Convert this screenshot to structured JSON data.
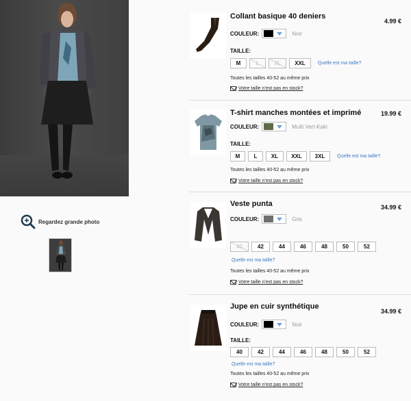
{
  "left": {
    "zoom_label": "Regardez grande photo"
  },
  "colors": {
    "link": "#3a78c2",
    "dropdown_arrow": "#6a9fd4"
  },
  "products": [
    {
      "name": "Collant basique 40 deniers",
      "price": "4.99 €",
      "color_label": "COULEUR:",
      "color_name": "Noir",
      "swatch": "#000000",
      "size_label": "TAILLE:",
      "sizes": [
        {
          "label": "M",
          "available": true
        },
        {
          "label": "L",
          "available": false
        },
        {
          "label": "XL",
          "available": false
        },
        {
          "label": "XXL",
          "available": true
        }
      ],
      "guide": "Quelle est ma taille?",
      "note": "Toutes les tailles 40-52 au même prix",
      "stock": "Votre taille n'est pas en stock?"
    },
    {
      "name": "T-shirt manches montées et imprimé",
      "price": "19.99 €",
      "color_label": "COULEUR:",
      "color_name": "Multi Vert-Kaki",
      "swatch": "#5e6b45",
      "size_label": "TAILLE:",
      "sizes": [
        {
          "label": "M",
          "available": true
        },
        {
          "label": "L",
          "available": true
        },
        {
          "label": "XL",
          "available": true
        },
        {
          "label": "XXL",
          "available": true
        },
        {
          "label": "3XL",
          "available": true
        }
      ],
      "guide": "Quelle est ma taille?",
      "note": "Toutes les tailles 40-52 au même prix",
      "stock": "Votre taille n'est pas en stock?"
    },
    {
      "name": "Veste punta",
      "price": "34.99 €",
      "color_label": "COULEUR:",
      "color_name": "Gris",
      "swatch": "#6f6f6f",
      "size_label": "",
      "sizes": [
        {
          "label": "40",
          "available": false
        },
        {
          "label": "42",
          "available": true
        },
        {
          "label": "44",
          "available": true
        },
        {
          "label": "46",
          "available": true
        },
        {
          "label": "48",
          "available": true
        },
        {
          "label": "50",
          "available": true
        },
        {
          "label": "52",
          "available": true
        }
      ],
      "guide": "Quelle est ma taille?",
      "note": "Toutes les tailles 40-52 au même prix",
      "stock": "Votre taille n'est pas en stock?"
    },
    {
      "name": "Jupe en cuir synthétique",
      "price": "34.99 €",
      "color_label": "COULEUR:",
      "color_name": "Noir",
      "swatch": "#000000",
      "size_label": "TAILLE:",
      "sizes": [
        {
          "label": "40",
          "available": true
        },
        {
          "label": "42",
          "available": true
        },
        {
          "label": "44",
          "available": true
        },
        {
          "label": "46",
          "available": true
        },
        {
          "label": "48",
          "available": true
        },
        {
          "label": "50",
          "available": true
        },
        {
          "label": "52",
          "available": true
        }
      ],
      "guide": "Quelle est ma taille?",
      "note": "Toutes les tailles 40-52 au même prix",
      "stock": "Votre taille n'est pas en stock?"
    }
  ]
}
